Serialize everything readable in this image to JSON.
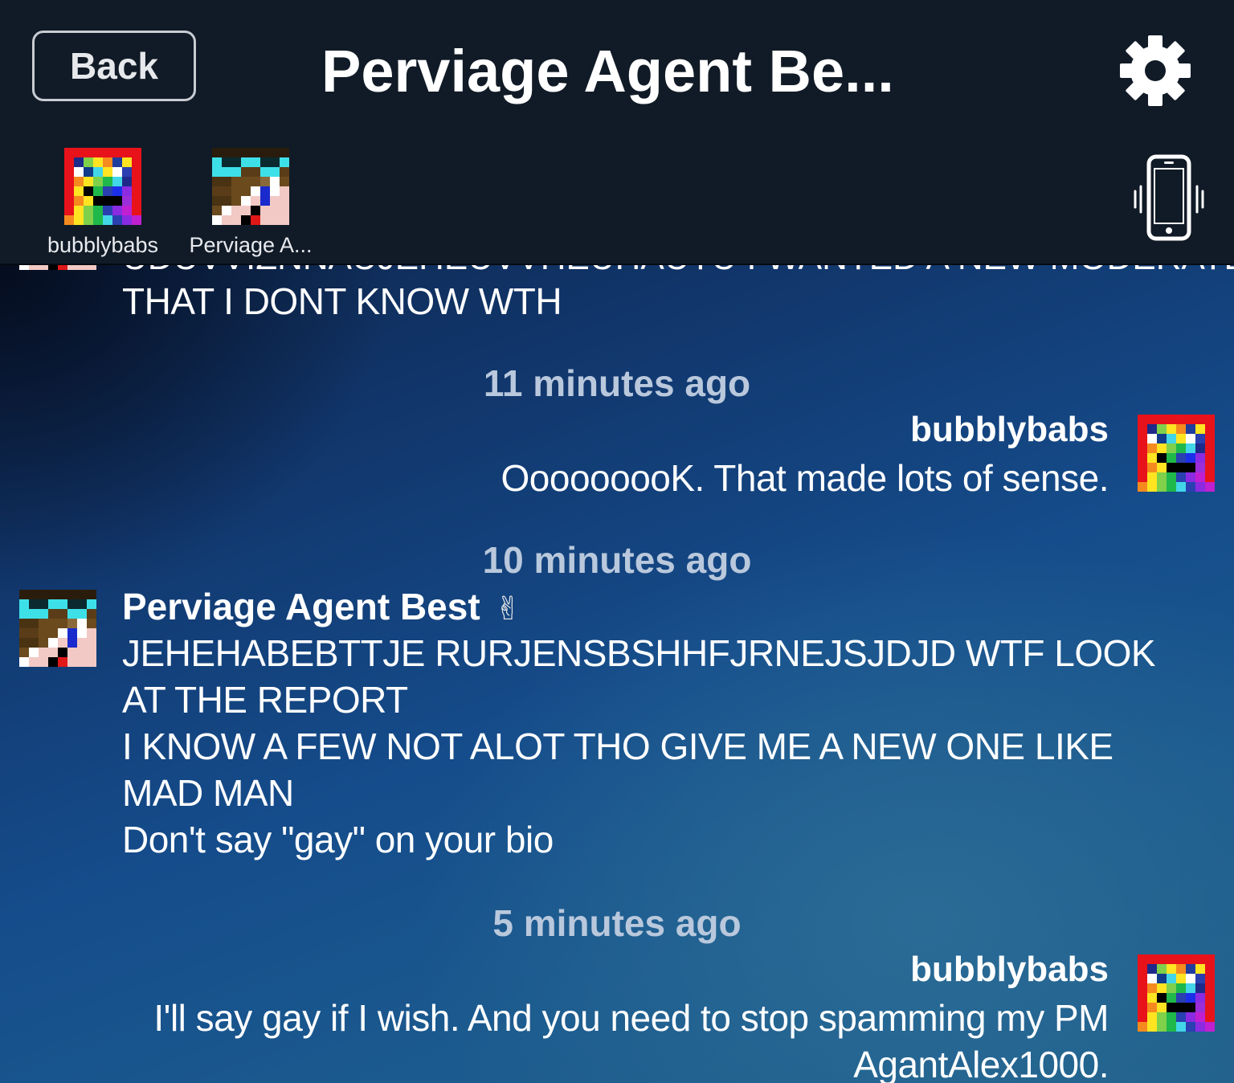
{
  "header": {
    "back_label": "Back",
    "title": "Perviage Agent Be...",
    "settings_icon": "gear-icon",
    "vibrate_icon": "phone-vibrate-icon",
    "participants": [
      {
        "name": "bubblybabs",
        "avatar": "rainbow-pixel-avatar"
      },
      {
        "name": "Perviage A...",
        "avatar": "sunglasses-pixel-avatar"
      }
    ]
  },
  "chat": {
    "clipped_partial_line": "UDUVVIZNNAUJEHEUVVHEUHAUTU I WANTED A NEW MODERATER",
    "first_visible_line": "THAT I DONT KNOW WTH",
    "messages": [
      {
        "time": "11 minutes ago",
        "sender": "bubblybabs",
        "lines": [
          "OoooooooK.  That made lots of sense."
        ]
      },
      {
        "time": "10 minutes ago",
        "sender": "Perviage Agent Best",
        "sender_emoji": "✌",
        "lines": [
          "JEHEHABEBTTJE RURJENSBSHHFJRNEJSJDJD WTF LOOK",
          "AT THE REPORT",
          "I KNOW A FEW NOT ALOT THO GIVE ME A NEW ONE LIKE",
          "MAD MAN",
          "Don't say \"gay\" on your bio"
        ]
      },
      {
        "time": "5 minutes ago",
        "sender": "bubblybabs",
        "lines": [
          "I'll say gay if I wish.  And you need to stop spamming my PM",
          "AgantAlex1000."
        ]
      }
    ]
  },
  "colors": {
    "header_bg": "#111b27",
    "timestamp": "#b9c8dc",
    "text": "#ffffff"
  }
}
